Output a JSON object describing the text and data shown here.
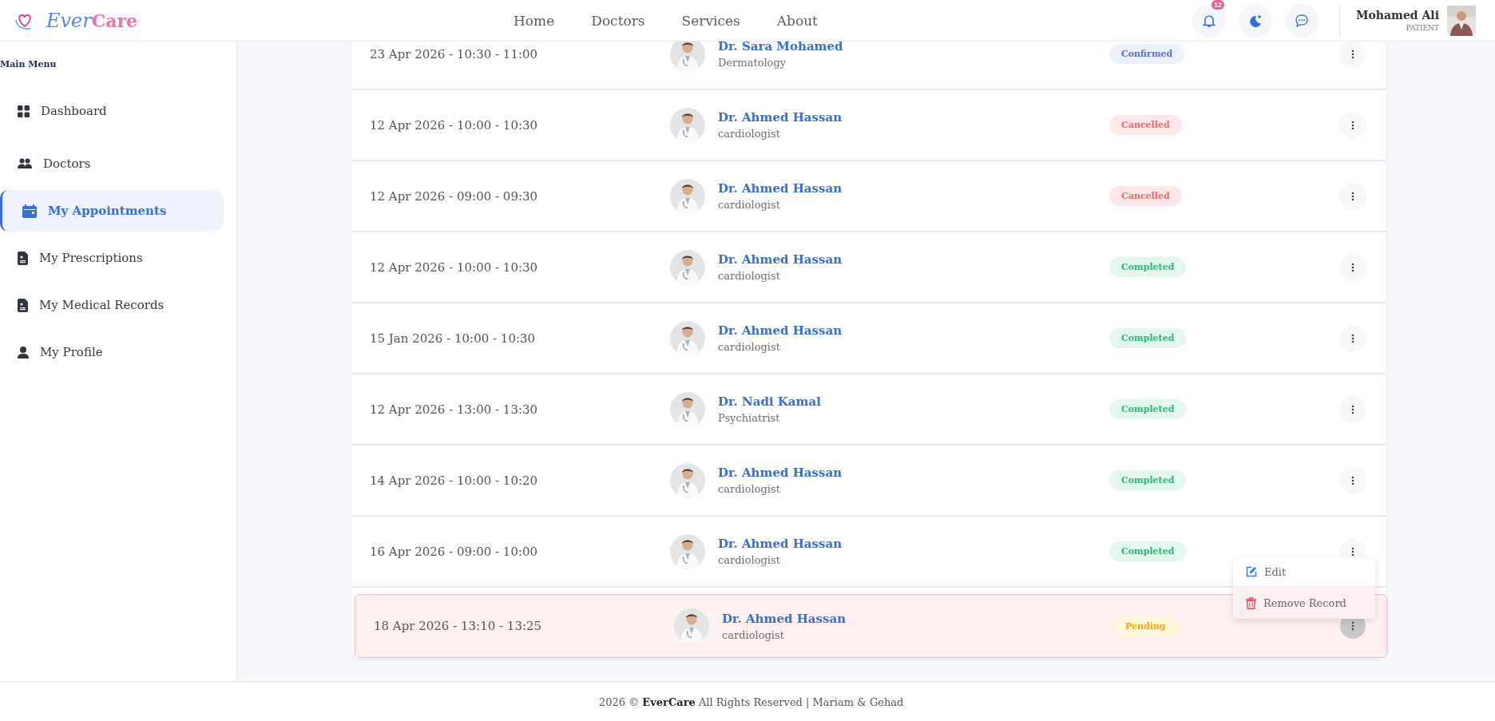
{
  "header": {
    "logo": {
      "part_1": "Ever",
      "part_2": "Care"
    },
    "nav": [
      {
        "label": "Home"
      },
      {
        "label": "Doctors"
      },
      {
        "label": "Services"
      },
      {
        "label": "About"
      }
    ],
    "notifications_badge": "12",
    "user": {
      "name": "Mohamed Ali",
      "role": "PATIENT"
    }
  },
  "sidebar": {
    "title": "Main Menu",
    "items": [
      {
        "label": "Dashboard",
        "selected": false
      },
      {
        "label": "Doctors",
        "selected": false
      },
      {
        "label": "My Appointments",
        "selected": true
      },
      {
        "label": "My Prescriptions",
        "selected": false
      },
      {
        "label": "My Medical Records",
        "selected": false
      },
      {
        "label": "My Profile",
        "selected": false
      }
    ]
  },
  "appointments": [
    {
      "time": "23 Apr 2026 - 10:30 - 11:00",
      "doctor": "Dr. Sara Mohamed",
      "specialty": "Dermatology",
      "status": "Confirmed",
      "kind": "confirmed",
      "highlighted": false
    },
    {
      "time": "12 Apr 2026 - 10:00 - 10:30",
      "doctor": "Dr. Ahmed Hassan",
      "specialty": "cardiologist",
      "status": "Cancelled",
      "kind": "cancelled",
      "highlighted": false
    },
    {
      "time": "12 Apr 2026 - 09:00 - 09:30",
      "doctor": "Dr. Ahmed Hassan",
      "specialty": "cardiologist",
      "status": "Cancelled",
      "kind": "cancelled",
      "highlighted": false
    },
    {
      "time": "12 Apr 2026 - 10:00 - 10:30",
      "doctor": "Dr. Ahmed Hassan",
      "specialty": "cardiologist",
      "status": "Completed",
      "kind": "completed",
      "highlighted": false
    },
    {
      "time": "15 Jan 2026 - 10:00 - 10:30",
      "doctor": "Dr. Ahmed Hassan",
      "specialty": "cardiologist",
      "status": "Completed",
      "kind": "completed",
      "highlighted": false
    },
    {
      "time": "12 Apr 2026 - 13:00 - 13:30",
      "doctor": "Dr. Nadi Kamal",
      "specialty": "Psychiatrist",
      "status": "Completed",
      "kind": "completed",
      "highlighted": false
    },
    {
      "time": "14 Apr 2026 - 10:00 - 10:20",
      "doctor": "Dr. Ahmed Hassan",
      "specialty": "cardiologist",
      "status": "Completed",
      "kind": "completed",
      "highlighted": false
    },
    {
      "time": "16 Apr 2026 - 09:00 - 10:00",
      "doctor": "Dr. Ahmed Hassan",
      "specialty": "cardiologist",
      "status": "Completed",
      "kind": "completed",
      "highlighted": false
    },
    {
      "time": "18 Apr 2026 - 13:10 - 13:25",
      "doctor": "Dr. Ahmed Hassan",
      "specialty": "cardiologist",
      "status": "Pending",
      "kind": "pending",
      "highlighted": true,
      "menu": [
        {
          "label": "Edit",
          "kind": "edit"
        },
        {
          "label": "Remove Record",
          "kind": "remove"
        }
      ]
    }
  ],
  "footer": "2026 © **EverCare** All Rights Reserved | Mariam & Gehad"
}
